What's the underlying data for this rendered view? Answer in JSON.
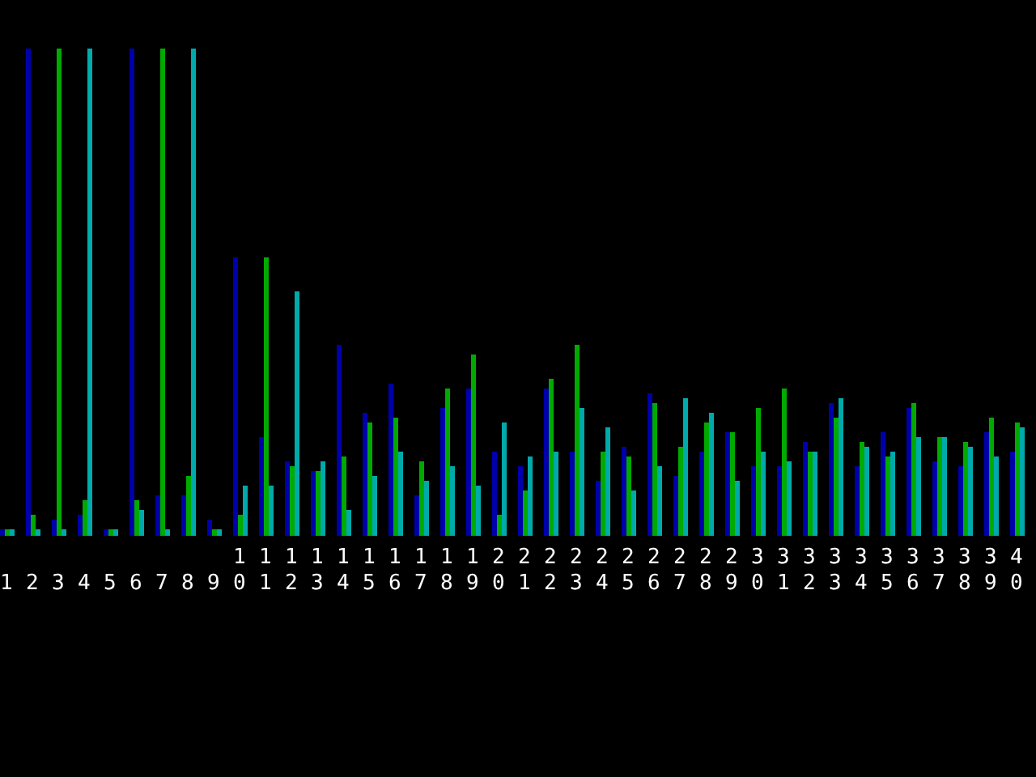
{
  "chart": {
    "categories": [
      "1",
      "2",
      "3",
      "4",
      "5",
      "6",
      "7",
      "8",
      "9",
      "10",
      "11",
      "12",
      "13",
      "14",
      "15",
      "16",
      "17",
      "18",
      "19",
      "20",
      "21",
      "22",
      "23",
      "24",
      "25",
      "26",
      "27",
      "28",
      "29",
      "30",
      "31",
      "32",
      "33",
      "34",
      "35",
      "36",
      "37",
      "38",
      "39",
      "40"
    ]
  }
}
